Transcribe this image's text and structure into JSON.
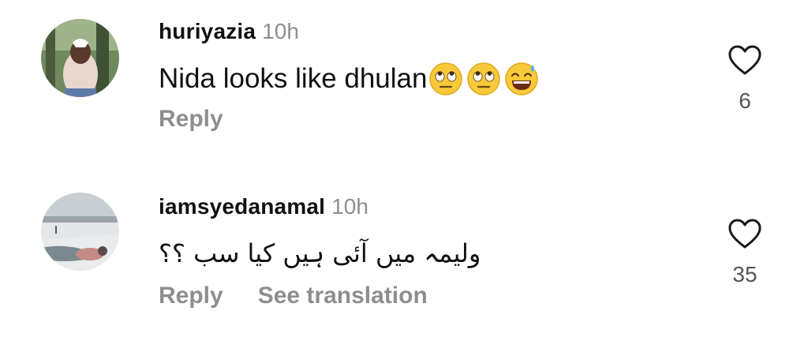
{
  "comments": [
    {
      "username": "huriyazia",
      "time": "10h",
      "text": "Nida looks like dhulan",
      "emojis": [
        "face-with-rolling-eyes-emoji",
        "face-with-rolling-eyes-emoji",
        "grinning-face-with-sweat-emoji"
      ],
      "actions": [
        "Reply"
      ],
      "likes": "6"
    },
    {
      "username": "iamsyedanamal",
      "time": "10h",
      "text": "ولیمہ میں آئی ہیں کیا سب ؟؟",
      "actions": [
        "Reply",
        "See translation"
      ],
      "likes": "35"
    }
  ],
  "icons": {
    "like": "heart-outline-icon"
  },
  "colors": {
    "username": "#111111",
    "meta": "#8e8e8e",
    "like_count": "#555555",
    "background": "#ffffff"
  }
}
